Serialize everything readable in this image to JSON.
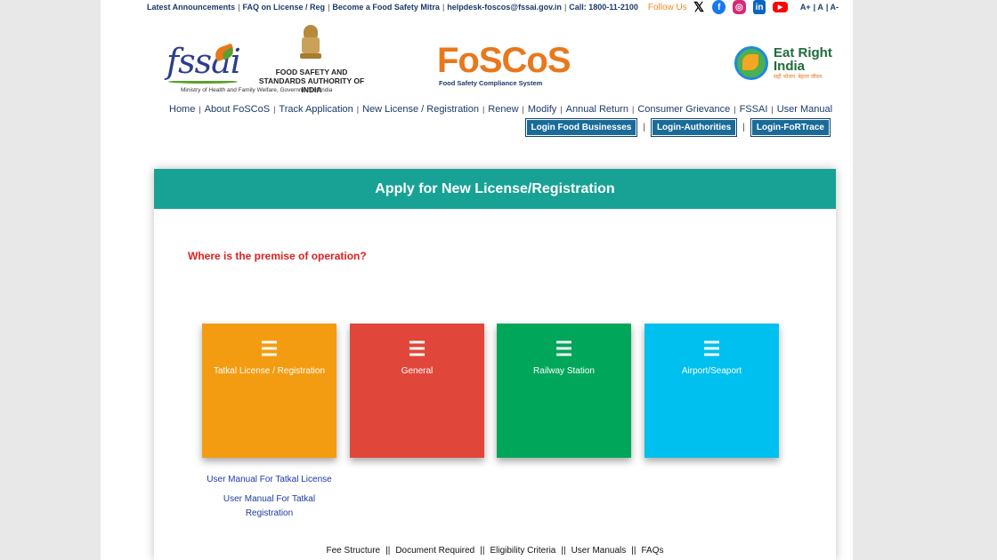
{
  "topbar": {
    "links": [
      "Latest Announcements",
      "FAQ on License / Reg",
      "Become a Food Safety Mitra",
      "helpdesk-foscos@fssai.gov.in",
      "Call: 1800-11-2100"
    ],
    "follow_label": "Follow Us",
    "social_icons": [
      "x-icon",
      "facebook-icon",
      "instagram-icon",
      "linkedin-icon",
      "youtube-icon"
    ],
    "font_sizes": [
      "A+",
      "A",
      "A-"
    ]
  },
  "header": {
    "fssai_logo": "fssai",
    "fssai_name": "FOOD SAFETY AND STANDARDS AUTHORITY OF INDIA",
    "ministry": "Ministry of Health and Family Welfare, Government of India",
    "foscos_logo": "FoSCoS",
    "foscos_subtitle": "Food Safety Compliance System",
    "eatright_line1": "Eat Right",
    "eatright_line2": "India",
    "eatright_tagline": "सही भोजन. बेहतर जीवन."
  },
  "nav": {
    "items": [
      "Home",
      "About FoSCoS",
      "Track Application",
      "New License / Registration",
      "Renew",
      "Modify",
      "Annual Return",
      "Consumer Grievance",
      "FSSAI",
      "User Manual"
    ],
    "login_buttons": [
      "Login Food Businesses",
      "Login-Authorities",
      "Login-FoRTrace"
    ]
  },
  "main": {
    "title": "Apply for New License/Registration",
    "question": "Where is the premise of operation?",
    "tiles": [
      {
        "label": "Tatkal License / Registration",
        "color": "#f39c12"
      },
      {
        "label": "General",
        "color": "#e0473a"
      },
      {
        "label": "Railway Station",
        "color": "#00a65a"
      },
      {
        "label": "Airport/Seaport",
        "color": "#00c0ef"
      }
    ],
    "manual_link_1": "User Manual For Tatkal License",
    "manual_link_2": "User Manual For Tatkal Registration",
    "footer_links": [
      "Fee Structure",
      "Document Required",
      "Eligibility Criteria",
      "User Manuals",
      "FAQs"
    ]
  },
  "colors": {
    "header_teal": "#17a295",
    "login_blue": "#1a6b99",
    "question_red": "#e02020",
    "brand_orange": "#e8781c"
  }
}
